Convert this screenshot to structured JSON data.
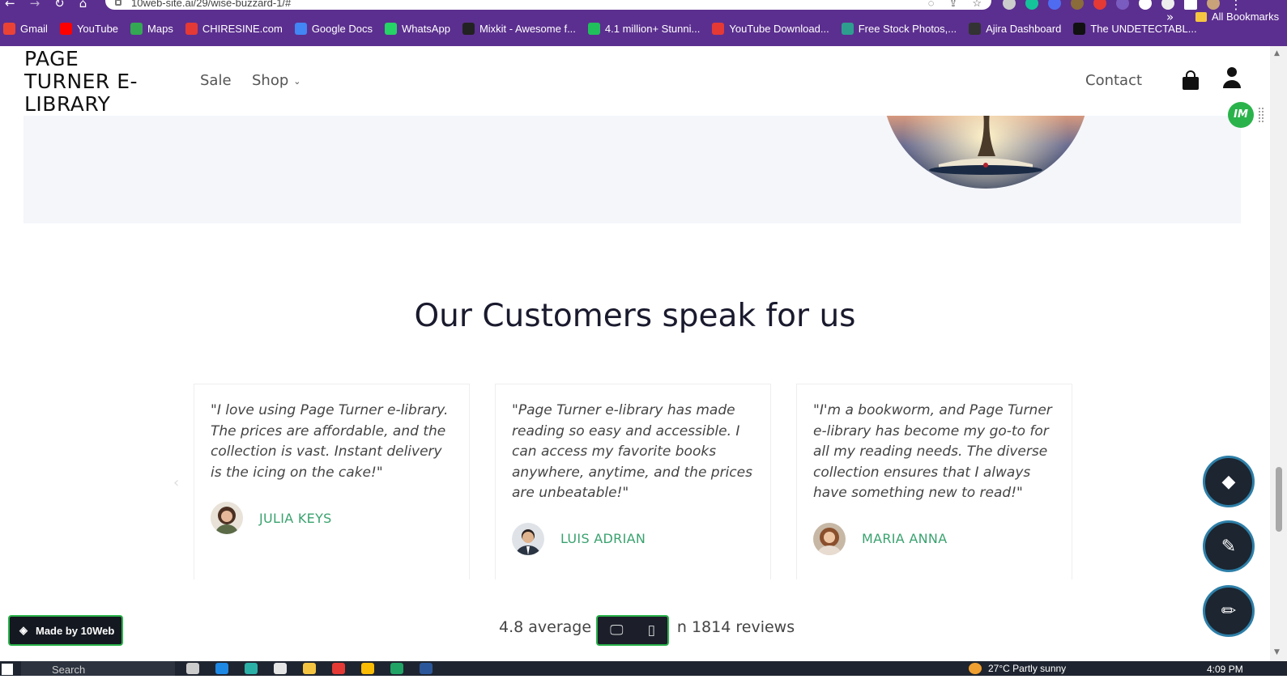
{
  "browser": {
    "url": "10web-site.ai/29/wise-buzzard-1/#",
    "bookmarks": [
      {
        "label": "Gmail",
        "color": "#ea4335"
      },
      {
        "label": "YouTube",
        "color": "#ff0000"
      },
      {
        "label": "Maps",
        "color": "#34a853"
      },
      {
        "label": "CHIRESINE.com",
        "color": "#e53935"
      },
      {
        "label": "Google Docs",
        "color": "#4285f4"
      },
      {
        "label": "WhatsApp",
        "color": "#25d366"
      },
      {
        "label": "Mixkit - Awesome f...",
        "color": "#222222"
      },
      {
        "label": "4.1 million+ Stunni...",
        "color": "#20c05c"
      },
      {
        "label": "YouTube Download...",
        "color": "#e53935"
      },
      {
        "label": "Free Stock Photos,...",
        "color": "#2e9e8f"
      },
      {
        "label": "Ajira Dashboard",
        "color": "#333333"
      },
      {
        "label": "The UNDETECTABL...",
        "color": "#111111"
      }
    ],
    "more": "»",
    "all_bookmarks": "All Bookmarks"
  },
  "header": {
    "logo": "PAGE TURNER E-LIBRARY",
    "nav_sale": "Sale",
    "nav_shop": "Shop",
    "nav_contact": "Contact"
  },
  "side_badge": "IM",
  "testimonials": {
    "title": "Our Customers speak for us",
    "items": [
      {
        "quote": "\"I love using Page Turner e-library. The prices are affordable, and the collection is vast. Instant delivery is the icing on the cake!\"",
        "name": "JULIA KEYS"
      },
      {
        "quote": "\"Page Turner e-library has made reading so easy and accessible. I can access my favorite books anywhere, anytime, and the prices are unbeatable!\"",
        "name": "LUIS ADRIAN"
      },
      {
        "quote": "\"I'm a bookworm, and Page Turner e-library has become my go-to for all my reading needs. The diverse collection ensures that I always have something new to read!\"",
        "name": "MARIA ANNA"
      }
    ],
    "rating_prefix": "4.8 average r",
    "rating_suffix": "n 1814 reviews"
  },
  "made_by": "Made by 10Web",
  "taskbar": {
    "search": "Search",
    "weather": "27°C  Partly sunny",
    "time": "4:09 PM"
  },
  "colors": {
    "brand_purple": "#5b2f8f",
    "accent_green": "#3aa26f",
    "fab_border": "#2d7fa8"
  }
}
